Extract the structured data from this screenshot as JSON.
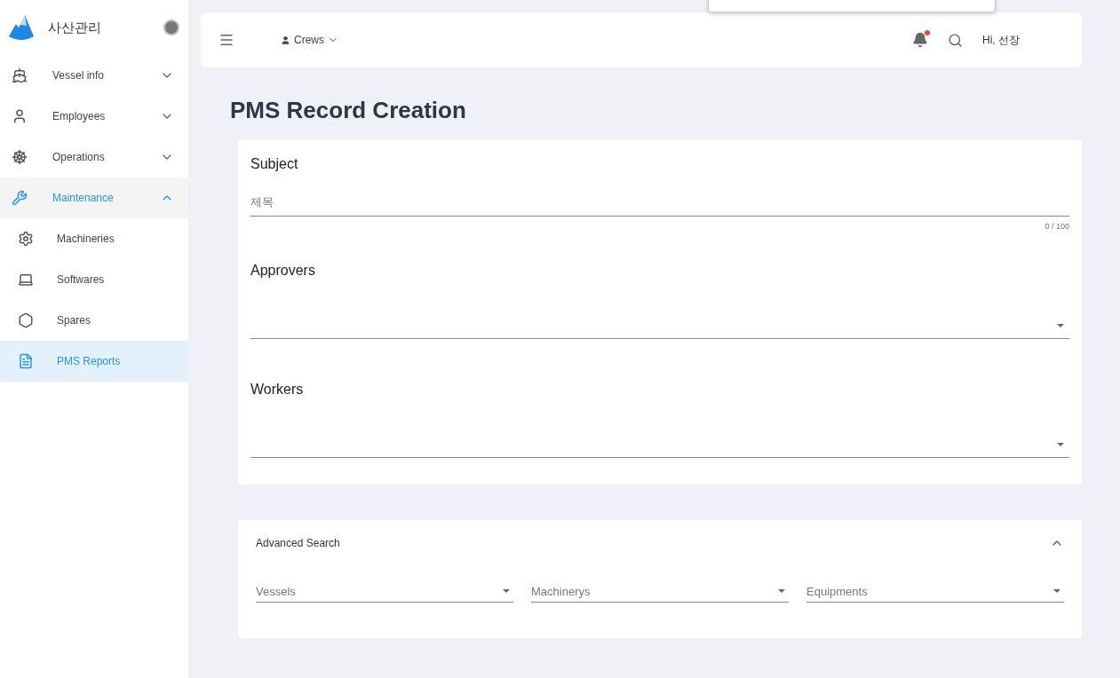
{
  "brand": {
    "title": "사산관리"
  },
  "sidebar": {
    "items": [
      {
        "label": "Vessel info",
        "expanded": false,
        "selected": false
      },
      {
        "label": "Employees",
        "expanded": false,
        "selected": false
      },
      {
        "label": "Operations",
        "expanded": false,
        "selected": false
      },
      {
        "label": "Maintenance",
        "expanded": true,
        "selected": true,
        "children": [
          {
            "label": "Machineries",
            "selected": false
          },
          {
            "label": "Softwares",
            "selected": false
          },
          {
            "label": "Spares",
            "selected": false
          },
          {
            "label": "PMS Reports",
            "selected": true
          }
        ]
      }
    ]
  },
  "topbar": {
    "menu": "Crews",
    "notifications": true,
    "greeting": "Hi, 선장"
  },
  "page": {
    "title": "PMS Record Creation"
  },
  "form": {
    "sections": [
      {
        "kind": "text",
        "title": "Subject",
        "placeholder": "제목",
        "counter": "0 / 100"
      },
      {
        "kind": "select",
        "title": "Approvers"
      },
      {
        "kind": "select",
        "title": "Workers"
      }
    ]
  },
  "advanced_search": {
    "title": "Advanced Search",
    "expanded": true,
    "fields": [
      {
        "placeholder": "Vessels"
      },
      {
        "placeholder": "Machinerys"
      },
      {
        "placeholder": "Equipments"
      }
    ]
  }
}
